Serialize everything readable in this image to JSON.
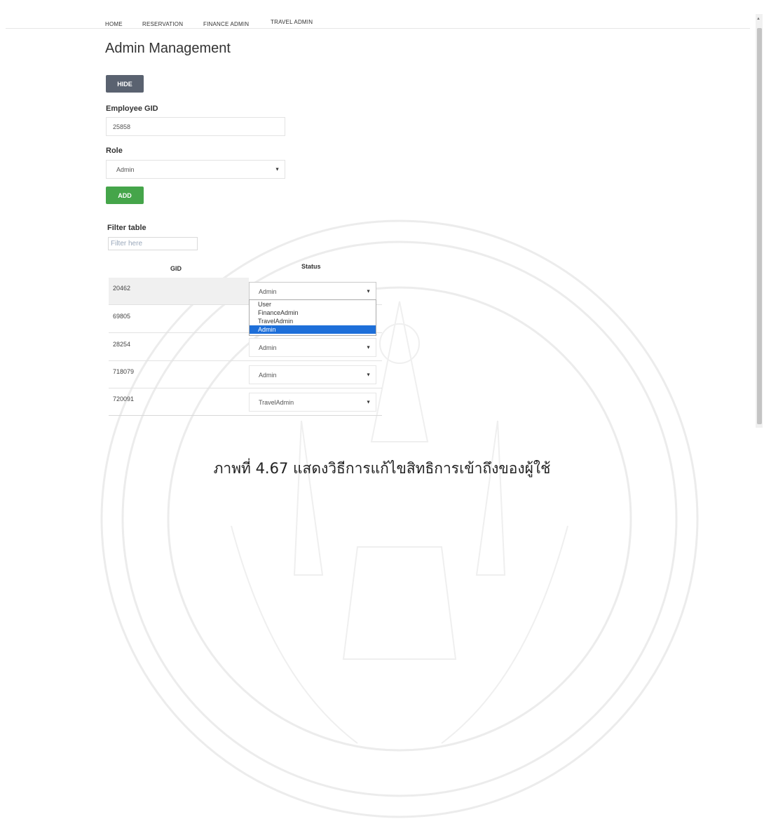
{
  "nav": {
    "items": [
      "HOME",
      "RESERVATION",
      "FINANCE ADMIN",
      "TRAVEL ADMIN"
    ]
  },
  "page": {
    "title": "Admin Management"
  },
  "form": {
    "hide_label": "HIDE",
    "employee_gid_label": "Employee GID",
    "employee_gid_value": "25858",
    "role_label": "Role",
    "role_value": "Admin",
    "add_label": "ADD"
  },
  "filter": {
    "label": "Filter table",
    "placeholder": "Filter here"
  },
  "table": {
    "headers": {
      "gid": "GID",
      "status": "Status"
    },
    "rows": [
      {
        "gid": "20462",
        "status": "Admin"
      },
      {
        "gid": "69805",
        "status": ""
      },
      {
        "gid": "28254",
        "status": "Admin"
      },
      {
        "gid": "718079",
        "status": "Admin"
      },
      {
        "gid": "720091",
        "status": "TravelAdmin"
      }
    ]
  },
  "dropdown": {
    "options": [
      "User",
      "FinanceAdmin",
      "TravelAdmin",
      "Admin"
    ],
    "selected": "Admin"
  },
  "caption": "ภาพที่ 4.67 แสดงวิธีการแก้ไขสิทธิการเข้าถึงของผู้ใช้",
  "colors": {
    "hide_button": "#5a6270",
    "add_button": "#45a54a",
    "dropdown_selected": "#1e6fd9"
  }
}
